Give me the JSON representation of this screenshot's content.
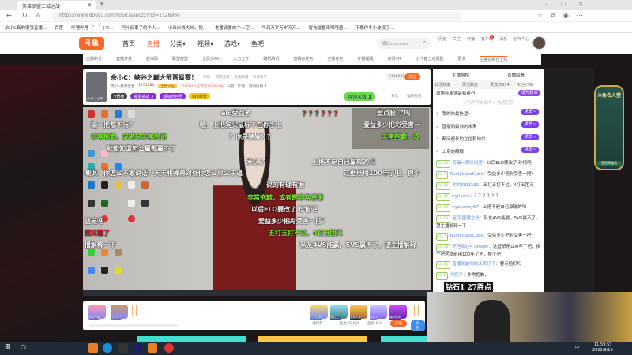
{
  "browser": {
    "tab_title": "英雄联盟三城之战",
    "url": "https://www.douyu.com/topic/sanczz?rid=1126960",
    "bookmarks": [
      "余小C真的很强直播...",
      "百度",
      "哔哩哔哩（゜-゜)つ...",
      "阿斗旧事了的个人...",
      "小米米饶大米，搜...",
      "老番谈番的个人空...",
      "牛叔万岁万岁万万...",
      "冒充逗鱼来呀哦量...",
      "下载你冬小皮没了..."
    ]
  },
  "site": {
    "logo": "斗鱼",
    "nav": [
      "首页",
      "直播",
      "分类▾",
      "视频▾",
      "游戏▾",
      "鱼吧"
    ],
    "search_placeholder": "解说summer",
    "user_icons": [
      "历史",
      "关注",
      "开播",
      "客户端",
      "消息",
      "创作中心"
    ],
    "badge_count": "8",
    "subnav": [
      "主播积分",
      "直播开关",
      "教练码",
      "联盟控盟",
      "全民乐PK",
      "火力全开",
      "路机刷机",
      "直播有任务",
      "主播任务",
      "开播提醒",
      "房间VIP",
      "小飞猫分成调整",
      "更多"
    ],
    "subnav_notice": "主播控制已上线"
  },
  "room": {
    "title": "余小C：峡谷之巅大师晋级赛！",
    "report": "举报",
    "category": "网游竞技 • 英雄联盟 • 大神教学",
    "streamer": "余小C真的很强",
    "hot": "1701282",
    "fan_badge": "主播认证",
    "tag": "2020LOL全明星solokong",
    "guild": "公会：护盾",
    "room_menu": "房间信箱 4",
    "followers": "5138042",
    "follow": "关注",
    "avatar_label": "余小C  | 公网",
    "pills": [
      "V贡榜",
      "福星挑战 3",
      "超级粉丝团",
      "LV6荣誉"
    ],
    "counter_label": "可领次数",
    "counter_value": "1",
    "share": "分享",
    "report2": "福利签到"
  },
  "danmaku": [
    {
      "t": "elo受益者",
      "c": ""
    },
    {
      "t": "？？？？？？",
      "c": "r"
    },
    {
      "t": "爱点脸 了吗",
      "c": ""
    },
    {
      "t": "输一把都不行？",
      "c": ""
    },
    {
      "t": "哦，上把狗头鼠标不在你手上",
      "c": ""
    },
    {
      "t": "爱益多少把彩受害一",
      "c": ""
    },
    {
      "t": "非常抱歉，或者是非常感谢",
      "c": "g"
    },
    {
      "t": "？你是躺输》？",
      "c": ""
    },
    {
      "t": "非常抱歉，或",
      "c": "g"
    },
    {
      "t": "就能知道怎么赢都赢不了",
      "c": ""
    },
    {
      "t": "承认了",
      "c": ""
    },
    {
      "t": "上把不是自己赢输的吗",
      "c": ""
    },
    {
      "t": "嘲讽：你怎么不敢说话？天天和弹幕对线你怎么那么牛逼",
      "c": ""
    },
    {
      "t": "这壁纸用100年了吧，换个",
      "c": ""
    },
    {
      "t": "说的有理有据",
      "c": ""
    },
    {
      "t": "非常抱歉，或者是非常感谢",
      "c": "g"
    },
    {
      "t": "以后ELO要改了 珍惜吧",
      "c": ""
    },
    {
      "t": "爱益多少把彩受害一把？",
      "c": ""
    },
    {
      "t": "五打五打不过，4打五团灭",
      "c": "g"
    },
    {
      "t": "队友4VS能赢，5VS赢不了，望主播解释",
      "c": ""
    },
    {
      "t": "益是吧",
      "c": ""
    },
    {
      "t": "把又输了",
      "c": "r"
    },
    {
      "t": "播解释一下",
      "c": ""
    }
  ],
  "giftbar": {
    "left_gifts": [
      "观看升级",
      "任务大厅"
    ],
    "right_gifts": [
      "贝贝成就",
      "宝石之王",
      "全能风暴",
      "香港1",
      "福利签到"
    ],
    "welfare": "福利券›",
    "fish_balls": "鱼丸 38422",
    "fish_fins": "鱼翅 0.3",
    "recharge": "充值",
    "backpack": "背包"
  },
  "chat": {
    "tabs_top": [
      "主播榜榜",
      "直播回看"
    ],
    "tabs": [
      "日活跃度",
      "周活跃度",
      "贵宾(6354)",
      "粉丝(56)"
    ],
    "rank_title": "按照帅笔速最稳排行",
    "become_fan": "成为粉丝",
    "rank_hint": "＜为严禁未成年人充值打赏",
    "rank": [
      {
        "n": "1",
        "name": "我的你最失望~",
        "btn": "求赞~"
      },
      {
        "n": "2",
        "name": "直播间最帅的未来",
        "btn": "求赞~"
      },
      {
        "n": "3",
        "name": "都问超长的立位和地尔",
        "btn": "求赞~"
      },
      {
        "n": "4",
        "name": "上帝的解锁",
        "btn": "求赞~"
      }
    ],
    "messages": [
      {
        "lv": "LV 18",
        "name": "剪辑一喇叭闭室：",
        "text": "以后ELO要改了 珍惜吧"
      },
      {
        "lv": "LV 7",
        "name": "RustyLakeCube：",
        "text": "受益多少把彩受害一把?"
      },
      {
        "lv": "LV 20",
        "name": "你的f902330：",
        "text": "五打五打不过，4打五团灭"
      },
      {
        "lv": "LV 31",
        "name": "hyhaero：",
        "text": "？？？？？？"
      },
      {
        "lv": "LV 14",
        "name": "hypocrisy67：",
        "text": "上把不是自己赢输的吗"
      },
      {
        "lv": "LV 13",
        "name": "至尽·圆魔之光：",
        "text": "队友4VS能赢，5VS赢不了，望主播解释一下"
      },
      {
        "lv": "LV 7",
        "name": "RustyLakeCube：",
        "text": "受益多少把彩受害一把?"
      },
      {
        "lv": "LV 18",
        "name": "不但知心• Timber：",
        "text": "这壁纸用100年了吧，换个吧这壁纸用100年了吧，换个吧"
      },
      {
        "lv": "LV 32",
        "name": "直播间最帅的未来仔子：",
        "text": "要点脸好吗"
      },
      {
        "lv": "LV 5",
        "name": "大屁子：",
        "text": "非常抱歉，"
      }
    ]
  },
  "overlay": {
    "rank_text": "钻石1  27胜点",
    "event_title": "斗鱼名人堂",
    "event_btn": "签到得道具"
  },
  "taskbar": {
    "time": "11:59:53",
    "date": "2022/9/16",
    "ime": "中"
  }
}
